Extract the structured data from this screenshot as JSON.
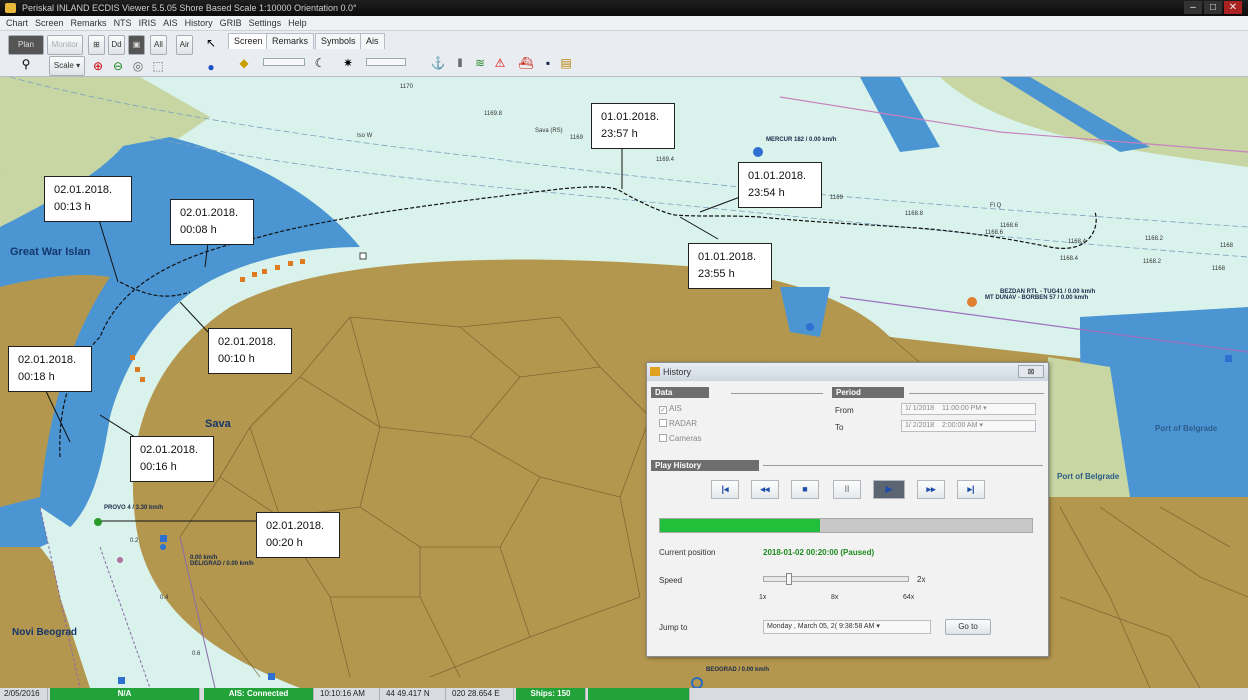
{
  "titlebar": {
    "title": "Periskal INLAND ECDIS Viewer 5.5.05  Shore Based    Scale 1:10000  Orientation    0.0°"
  },
  "menu": [
    "Chart",
    "Screen",
    "Remarks",
    "NTS",
    "IRIS",
    "AIS",
    "History",
    "GRIB",
    "Settings",
    "Help"
  ],
  "toolbar": {
    "plan": "Plan",
    "monitor": "Monitor",
    "scale": "Scale",
    "tabs": [
      "Screen",
      "Remarks",
      "Symbols",
      "Ais"
    ],
    "btn_ais_all": "All",
    "btn_air": "Air"
  },
  "map": {
    "labels": {
      "island": "Great War Islan",
      "sava": "Sava",
      "novi": "Novi Beograd",
      "port1": "Port of Belgrade",
      "port2": "Port of Belgrade"
    },
    "vessels": {
      "mercur": "MERCUR 182 / 0.00 km/h",
      "bezdan": "BEZDAN RTL - TUG41 / 0.00 km/h",
      "mtdunav": "MT DUNAV - BORBEN 57 / 0.00 km/h",
      "provo": "PROVO 4 / 3.30 km/h",
      "delikrad": "DELIGRAD / 0.00 km/h",
      "delikrad_speed": "0.00 km/h",
      "bottom": "BEOGRAD / 0.00 km/h"
    },
    "kms": [
      "1170",
      "1169.8",
      "1169",
      "1169.4",
      "1169",
      "1168.8",
      "1168.6",
      "1168.4",
      "1168.2",
      "1168",
      "1168.6",
      "1168.4",
      "1168.2",
      "1168"
    ],
    "small": {
      "sava_rs": "Sava (RS)",
      "iso": "Iso W",
      "flq": "Fl Q",
      "d1": "0.2",
      "d2": "0.4",
      "d3": "0.6"
    },
    "notes": [
      {
        "line1": "02.01.2018.",
        "line2": "00:13 h"
      },
      {
        "line1": "02.01.2018.",
        "line2": "00:08 h"
      },
      {
        "line1": "01.01.2018.",
        "line2": "23:57 h"
      },
      {
        "line1": "01.01.2018.",
        "line2": "23:54 h"
      },
      {
        "line1": "01.01.2018.",
        "line2": "23:55 h"
      },
      {
        "line1": "02.01.2018.",
        "line2": "00:10 h"
      },
      {
        "line1": "02.01.2018.",
        "line2": "00:18 h"
      },
      {
        "line1": "02.01.2018.",
        "line2": "00:16 h"
      },
      {
        "line1": "02.01.2018.",
        "line2": "00:20 h"
      }
    ]
  },
  "history": {
    "title": "History",
    "close": "⊠",
    "data_header": "Data",
    "period_header": "Period",
    "checks": {
      "ais": "AIS",
      "radar": "RADAR",
      "cameras": "Cameras"
    },
    "from_label": "From",
    "to_label": "To",
    "from_date": "1/ 1/2018",
    "from_time": "11:00:00 PM",
    "to_date": "1/ 2/2018",
    "to_time": "2:00:00 AM",
    "play_header": "Play History",
    "progress": 0.43,
    "current_position_label": "Current position",
    "current_position": "2018-01-02 00:20:00 (Paused)",
    "speed_label": "Speed",
    "speed_value": "2x",
    "speed_ticks": [
      "1x",
      "8x",
      "64x"
    ],
    "jump_label": "Jump to",
    "jump_value": "Monday ,   March   05, 2(  9:38:58 AM",
    "goto": "Go to"
  },
  "status": {
    "date": "2/05/2016",
    "na": "N/A",
    "ais": "AIS: Connected",
    "time": "10:10:16 AM",
    "lat": "44 49.417 N",
    "lon": "020 28.654 E",
    "ships": "Ships: 150"
  },
  "colors": {
    "water": "#d9f3ec",
    "land": "#b4974f",
    "deep": "#3e8ed2",
    "status_green": "#22a33a",
    "progress": "#22bf3a"
  }
}
